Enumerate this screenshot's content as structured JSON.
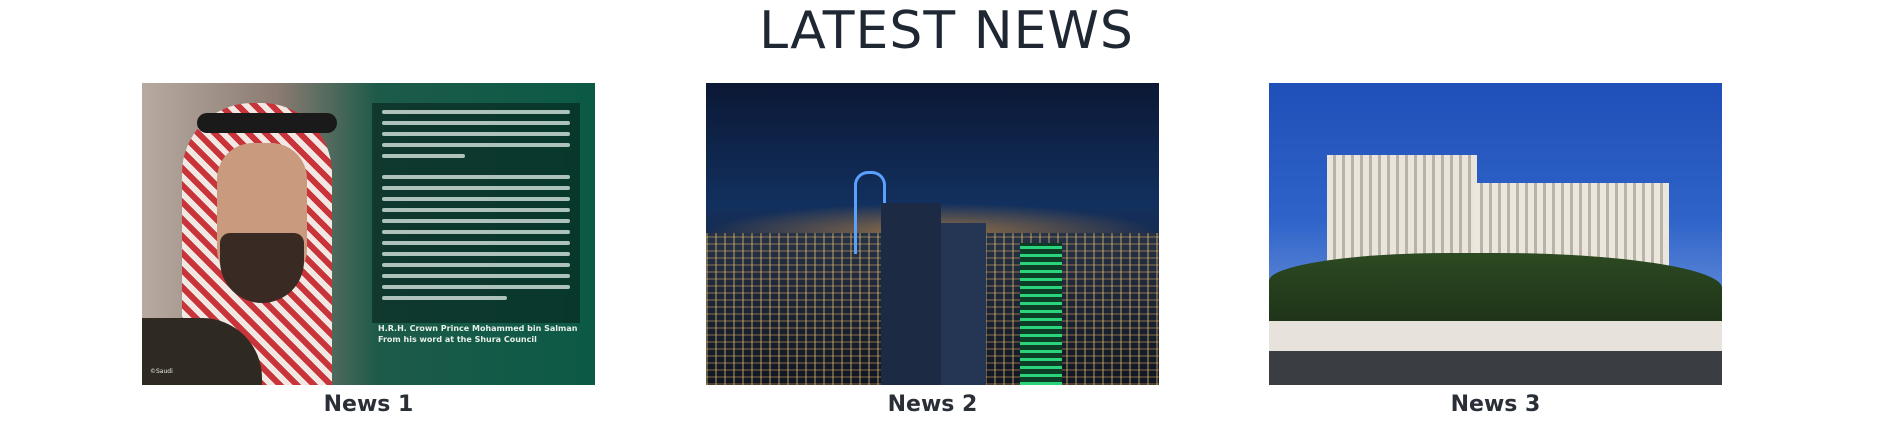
{
  "section": {
    "title": "LATEST NEWS"
  },
  "news": [
    {
      "label": "News 1",
      "image": {
        "quote_lines": [
          "H.R.H. Crown Prince Mohammed bin Salman",
          "From his word at the Shura Council"
        ],
        "credit": "©Saudi"
      }
    },
    {
      "label": "News 2"
    },
    {
      "label": "News 3"
    }
  ]
}
